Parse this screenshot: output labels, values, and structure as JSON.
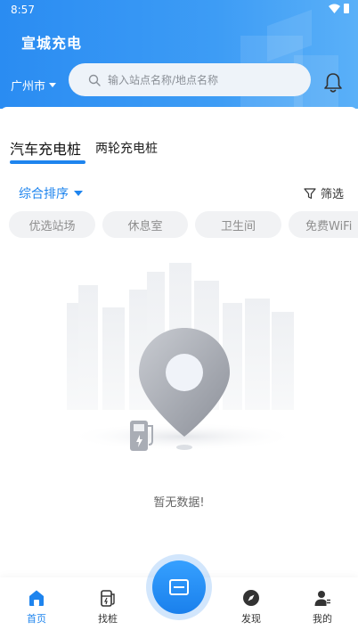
{
  "status_bar": {
    "time": "8:57"
  },
  "header": {
    "app_title": "宣城充电",
    "city": "广州市",
    "search_placeholder": "输入站点名称/地点名称"
  },
  "tabs": [
    {
      "label": "汽车充电桩",
      "active": true
    },
    {
      "label": "两轮充电桩",
      "active": false
    }
  ],
  "filters": {
    "sort_label": "综合排序",
    "filter_label": "筛选",
    "chips": [
      "优选站场",
      "休息室",
      "卫生间",
      "免费WiFi"
    ]
  },
  "empty_state": {
    "message": "暂无数据!"
  },
  "bottom_nav": {
    "items": [
      {
        "label": "首页",
        "icon": "home-icon",
        "active": true
      },
      {
        "label": "找桩",
        "icon": "charging-pile-icon",
        "active": false
      },
      {
        "label": "发现",
        "icon": "compass-icon",
        "active": false
      },
      {
        "label": "我的",
        "icon": "user-icon",
        "active": false
      }
    ],
    "center_icon": "scan-icon"
  },
  "colors": {
    "primary": "#1e84ee",
    "header_start": "#2a8cf2",
    "header_end": "#5ab0f8"
  }
}
